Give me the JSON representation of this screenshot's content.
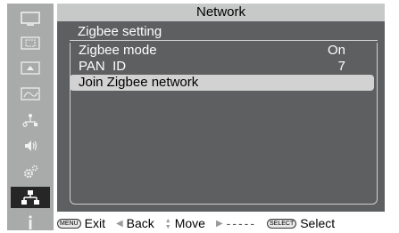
{
  "window": {
    "title": "Network"
  },
  "sidebar": {
    "items": [
      {
        "icon": "picture-icon",
        "active": false
      },
      {
        "icon": "display-icon",
        "active": false
      },
      {
        "icon": "input-icon",
        "active": false
      },
      {
        "icon": "image-adjust-icon",
        "active": false
      },
      {
        "icon": "setup-icon",
        "active": false
      },
      {
        "icon": "audio-icon",
        "active": false
      },
      {
        "icon": "settings-gear-icon",
        "active": false
      },
      {
        "icon": "network-icon",
        "active": true
      },
      {
        "icon": "info-icon",
        "active": false
      }
    ]
  },
  "panel": {
    "heading": "Zigbee setting",
    "rows": [
      {
        "label": "Zigbee mode",
        "value": "On"
      },
      {
        "label": "PAN  ID",
        "value": "7"
      },
      {
        "label": "Join Zigbee network",
        "value": ""
      }
    ]
  },
  "help": {
    "exit_key": "MENU",
    "exit_label": "Exit",
    "back_label": "Back",
    "move_label": "Move",
    "next_label": "-----",
    "select_key": "SELECT",
    "select_label": "Select"
  },
  "colors": {
    "sidebar": "#a9abab",
    "active_item": "#262626",
    "titlebar": "#c7c8c8",
    "panel": "#5e5f60",
    "highlight": "#d2d2d2"
  }
}
